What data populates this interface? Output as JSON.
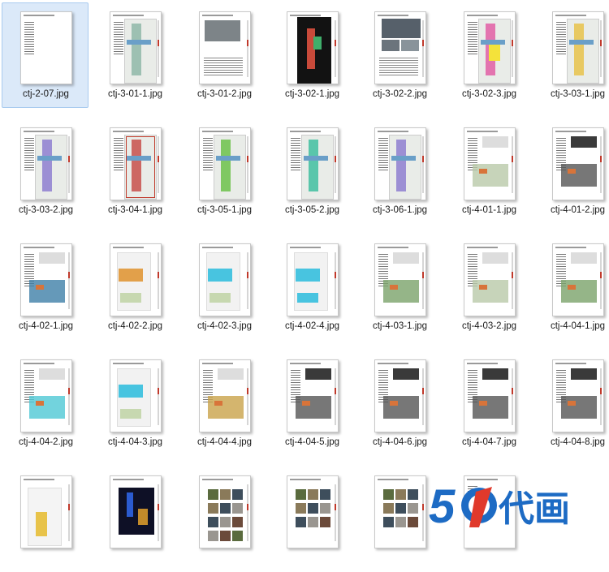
{
  "files": [
    {
      "name": "ctj-2-07.jpg",
      "kind": "text",
      "selected": true
    },
    {
      "name": "ctj-3-01-1.jpg",
      "kind": "map"
    },
    {
      "name": "ctj-3-01-2.jpg",
      "kind": "photo-top"
    },
    {
      "name": "ctj-3-02-1.jpg",
      "kind": "dark"
    },
    {
      "name": "ctj-3-02-2.jpg",
      "kind": "photos"
    },
    {
      "name": "ctj-3-02-3.jpg",
      "kind": "colormap"
    },
    {
      "name": "ctj-3-03-1.jpg",
      "kind": "map-yellow"
    },
    {
      "name": "ctj-3-03-2.jpg",
      "kind": "map-purple"
    },
    {
      "name": "ctj-3-04-1.jpg",
      "kind": "map-red"
    },
    {
      "name": "ctj-3-05-1.jpg",
      "kind": "map-green"
    },
    {
      "name": "ctj-3-05-2.jpg",
      "kind": "map-teal"
    },
    {
      "name": "ctj-3-06-1.jpg",
      "kind": "map-purple"
    },
    {
      "name": "ctj-4-01-1.jpg",
      "kind": "site"
    },
    {
      "name": "ctj-4-01-2.jpg",
      "kind": "site-dark"
    },
    {
      "name": "ctj-4-02-1.jpg",
      "kind": "site-blue"
    },
    {
      "name": "ctj-4-02-2.jpg",
      "kind": "plan"
    },
    {
      "name": "ctj-4-02-3.jpg",
      "kind": "plan-blue"
    },
    {
      "name": "ctj-4-02-4.jpg",
      "kind": "plan-small"
    },
    {
      "name": "ctj-4-03-1.jpg",
      "kind": "site-green"
    },
    {
      "name": "ctj-4-03-2.jpg",
      "kind": "site"
    },
    {
      "name": "ctj-4-04-1.jpg",
      "kind": "site-green"
    },
    {
      "name": "ctj-4-04-2.jpg",
      "kind": "site-cyan"
    },
    {
      "name": "ctj-4-04-3.jpg",
      "kind": "plan-blue"
    },
    {
      "name": "ctj-4-04-4.jpg",
      "kind": "site-color"
    },
    {
      "name": "ctj-4-04-5.jpg",
      "kind": "site-dark"
    },
    {
      "name": "ctj-4-04-6.jpg",
      "kind": "site-dark"
    },
    {
      "name": "ctj-4-04-7.jpg",
      "kind": "site-dark"
    },
    {
      "name": "ctj-4-04-8.jpg",
      "kind": "site-dark"
    },
    {
      "name": "",
      "kind": "section"
    },
    {
      "name": "",
      "kind": "night"
    },
    {
      "name": "",
      "kind": "gallery"
    },
    {
      "name": "",
      "kind": "gallery-small"
    },
    {
      "name": "",
      "kind": "gallery-small"
    },
    {
      "name": "",
      "kind": "plain"
    }
  ],
  "watermark": {
    "text": "50代画",
    "color_blue": "#1d6bc4",
    "color_red": "#e0392b"
  }
}
